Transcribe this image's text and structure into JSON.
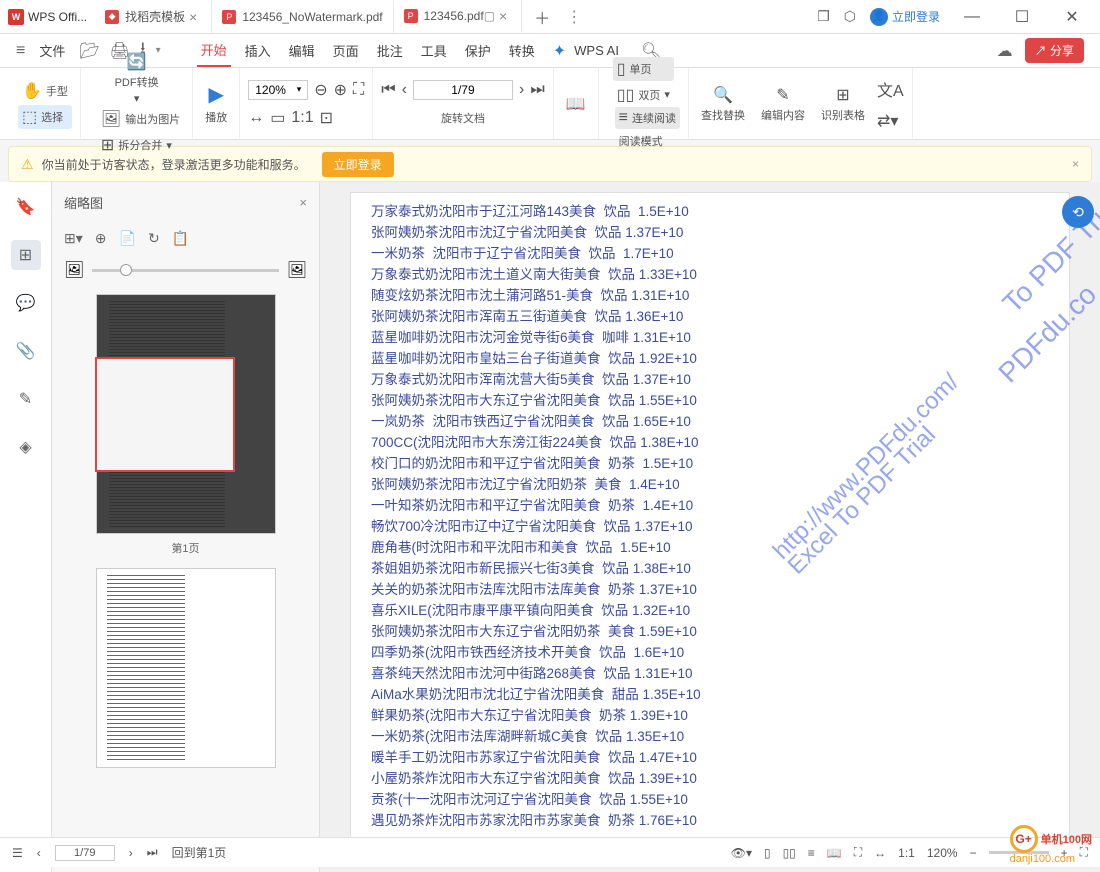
{
  "titlebar": {
    "app_name": "WPS Offi...",
    "tabs": [
      {
        "label": "找稻壳模板",
        "icon": "red"
      },
      {
        "label": "123456_NoWatermark.pdf",
        "icon": "pdf"
      },
      {
        "label": "123456.pdf",
        "icon": "pdf",
        "active": true
      }
    ],
    "login": "立即登录"
  },
  "menubar": {
    "file": "文件",
    "items": [
      "开始",
      "插入",
      "编辑",
      "页面",
      "批注",
      "工具",
      "保护",
      "转换"
    ],
    "active_index": 0,
    "wps_ai": "WPS AI",
    "share": "分享"
  },
  "ribbon": {
    "hand": "手型",
    "select": "选择",
    "pdf_convert": "PDF转换",
    "export_image": "输出为图片",
    "split_merge": "拆分合并",
    "play": "播放",
    "zoom": "120%",
    "page_current": "1/79",
    "rotate": "旋转文档",
    "single_page": "单页",
    "double_page": "双页",
    "continuous": "连续阅读",
    "read_mode": "阅读模式",
    "find_replace": "查找替换",
    "edit_content": "编辑内容",
    "detect_table": "识别表格"
  },
  "alert": {
    "message": "你当前处于访客状态，登录激活更多功能和服务。",
    "button": "立即登录"
  },
  "thumb": {
    "title": "缩略图",
    "pages": [
      "第1页"
    ]
  },
  "page_content": {
    "rows": [
      "万家泰式奶沈阳市于辽江河路143美食  饮品  1.5E+10",
      "张阿姨奶茶沈阳市沈辽宁省沈阳美食  饮品 1.37E+10",
      "一米奶茶  沈阳市于辽宁省沈阳美食  饮品  1.7E+10",
      "万象泰式奶沈阳市沈土道义南大街美食  饮品 1.33E+10",
      "随变炫奶茶沈阳市沈土蒲河路51-美食  饮品 1.31E+10",
      "张阿姨奶茶沈阳市浑南五三街道美食  饮品 1.36E+10",
      "蓝星咖啡奶沈阳市沈河金觉寺街6美食  咖啡 1.31E+10",
      "蓝星咖啡奶沈阳市皇姑三台子街道美食  饮品 1.92E+10",
      "万象泰式奶沈阳市浑南沈营大街5美食  饮品 1.37E+10",
      "张阿姨奶茶沈阳市大东辽宁省沈阳美食  饮品 1.55E+10",
      "一岚奶茶  沈阳市铁西辽宁省沈阳美食  饮品 1.65E+10",
      "700CC(沈阳沈阳市大东滂江街224美食  饮品 1.38E+10",
      "校门口的奶沈阳市和平辽宁省沈阳美食  奶茶  1.5E+10",
      "张阿姨奶茶沈阳市沈辽宁省沈阳奶茶  美食  1.4E+10",
      "一叶知茶奶沈阳市和平辽宁省沈阳美食  奶茶  1.4E+10",
      "畅饮700冷沈阳市辽中辽宁省沈阳美食  饮品 1.37E+10",
      "鹿角巷(时沈阳市和平沈阳市和美食  饮品  1.5E+10",
      "茶姐姐奶茶沈阳市新民振兴七街3美食  饮品 1.38E+10",
      "关关的奶茶沈阳市法库沈阳市法库美食  奶茶 1.37E+10",
      "喜乐XILE(沈阳市康平康平镇向阳美食  饮品 1.32E+10",
      "张阿姨奶茶沈阳市大东辽宁省沈阳奶茶  美食 1.59E+10",
      "四季奶茶(沈阳市铁西经济技术开美食  饮品  1.6E+10",
      "喜茶纯天然沈阳市沈河中街路268美食  饮品 1.31E+10",
      "AiMa水果奶沈阳市沈北辽宁省沈阳美食  甜品 1.35E+10",
      "鲜果奶茶(沈阳市大东辽宁省沈阳美食  奶茶 1.39E+10",
      "一米奶茶(沈阳市法库湖畔新城C美食  饮品 1.35E+10",
      "暖羊手工奶沈阳市苏家辽宁省沈阳美食  饮品 1.47E+10",
      "小屋奶茶炸沈阳市大东辽宁省沈阳美食  饮品 1.39E+10",
      "贡茶(十一沈阳市沈河辽宁省沈阳美食  饮品 1.55E+10",
      "遇见奶茶炸沈阳市苏家沈阳市苏家美食  奶茶 1.76E+10"
    ],
    "watermarks": [
      "PDFdu.co",
      "To PDF Trial",
      "http://www.PDFdu.com/\nExcel To PDF Trial"
    ]
  },
  "statusbar": {
    "page": "1/79",
    "back_to_first": "回到第1页",
    "zoom": "120%"
  },
  "brand": {
    "text": "单机100网",
    "url": "danji100.com"
  }
}
